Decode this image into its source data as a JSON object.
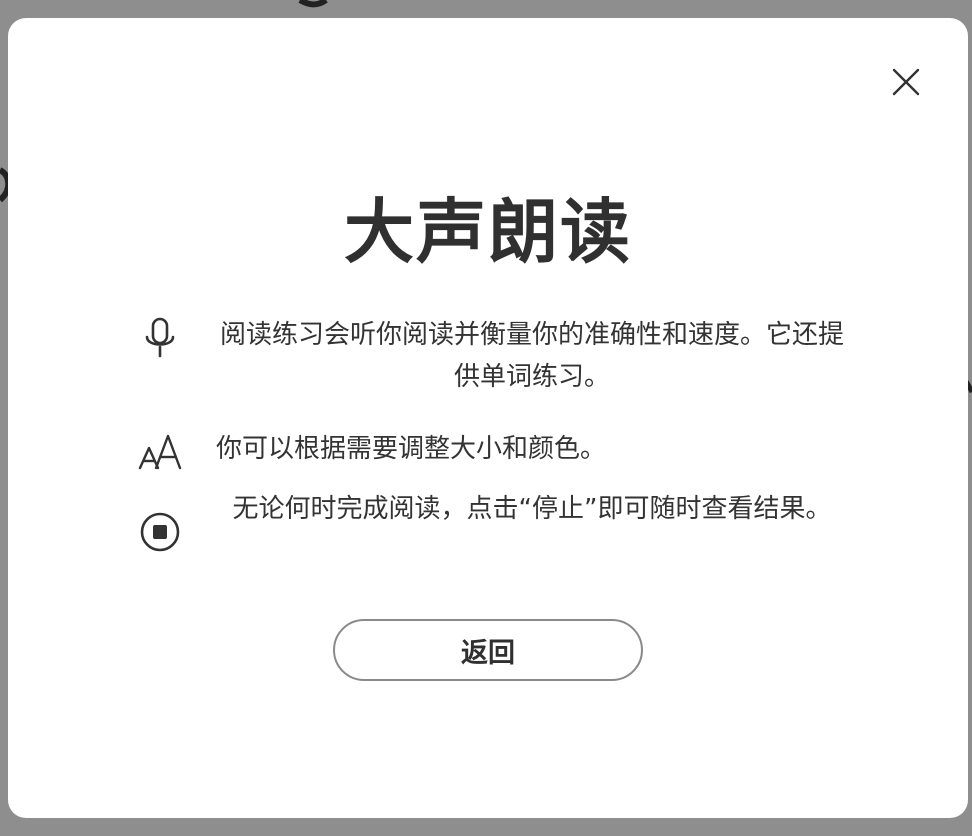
{
  "dialog": {
    "title": "大声朗读",
    "features": [
      {
        "icon": "microphone-icon",
        "text": "阅读练习会听你阅读并衡量你的准确性和速度。它还提供单词练习。"
      },
      {
        "icon": "text-size-icon",
        "text": "你可以根据需要调整大小和颜色。"
      },
      {
        "icon": "stop-icon",
        "text": "无论何时完成阅读，点击“停止”即可随时查看结果。"
      }
    ],
    "back_label": "返回",
    "close_icon": "close-icon"
  },
  "colors": {
    "backdrop": "#8e8e8e",
    "dialog_bg": "#ffffff",
    "text": "#333333",
    "button_border": "#8a8a8a"
  }
}
